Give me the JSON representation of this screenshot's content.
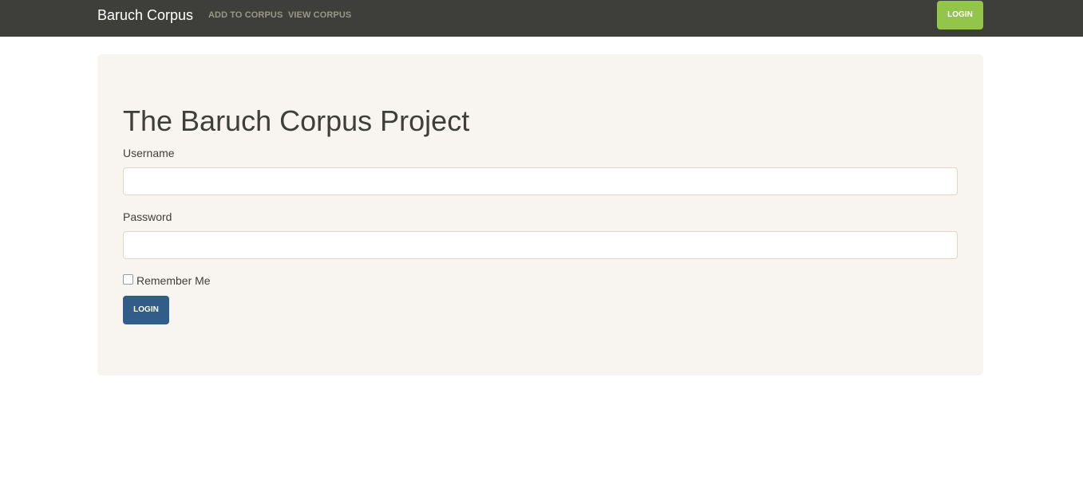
{
  "navbar": {
    "brand": "Baruch Corpus",
    "links": [
      "ADD TO CORPUS",
      "VIEW CORPUS"
    ],
    "login_label": "LOGIN",
    "background": "#3e3f3a",
    "login_color": "#93c54b"
  },
  "main": {
    "title": "The Baruch Corpus Project",
    "form": {
      "username_label": "Username",
      "username_value": "",
      "password_label": "Password",
      "password_value": "",
      "remember_label": "Remember Me",
      "remember_checked": false,
      "submit_label": "LOGIN",
      "submit_color": "#325d88"
    }
  }
}
